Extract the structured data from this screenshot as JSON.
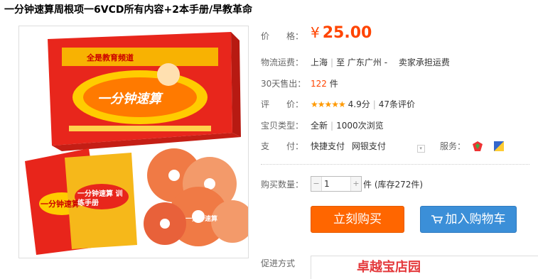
{
  "title": "一分钟速算周根项一6VCD所有内容+2本手册/早教革命",
  "product_image": {
    "box_top_text": "全是教育频道",
    "box_main_text": "一分钟速算",
    "book1_text": "一分钟速算",
    "book2_text": "一分钟速算 训练手册",
    "disc_text": "一分钟速算"
  },
  "price": {
    "label": "价　　格：",
    "currency": "¥",
    "value": "25.00"
  },
  "shipping": {
    "label": "物流运费：",
    "from": "上海",
    "to": "至  广东广州 -",
    "fee": "卖家承担运费"
  },
  "sold": {
    "label": "30天售出：",
    "count": "122",
    "unit": "件"
  },
  "rating": {
    "label": "评　　价：",
    "stars": "★★★★★",
    "score": "4.9分",
    "reviews": "47条评价"
  },
  "item_type": {
    "label": "宝贝类型：",
    "condition": "全新",
    "views": "1000次浏览"
  },
  "payment": {
    "label": "支　　付：",
    "method1": "快捷支付",
    "method2": "网银支付",
    "service_label": "服务："
  },
  "quantity": {
    "label": "购买数量：",
    "value": "1",
    "minus": "−",
    "plus": "+",
    "unit": "件",
    "stock": "(库存272件)"
  },
  "buttons": {
    "buy": "立刻购买",
    "cart": "加入购物车"
  },
  "bottom": {
    "label": "促进方式",
    "promo": "卓越宝店园"
  },
  "colors": {
    "accent": "#ff4400",
    "buy": "#ff6600",
    "cart": "#3b8fd8"
  }
}
